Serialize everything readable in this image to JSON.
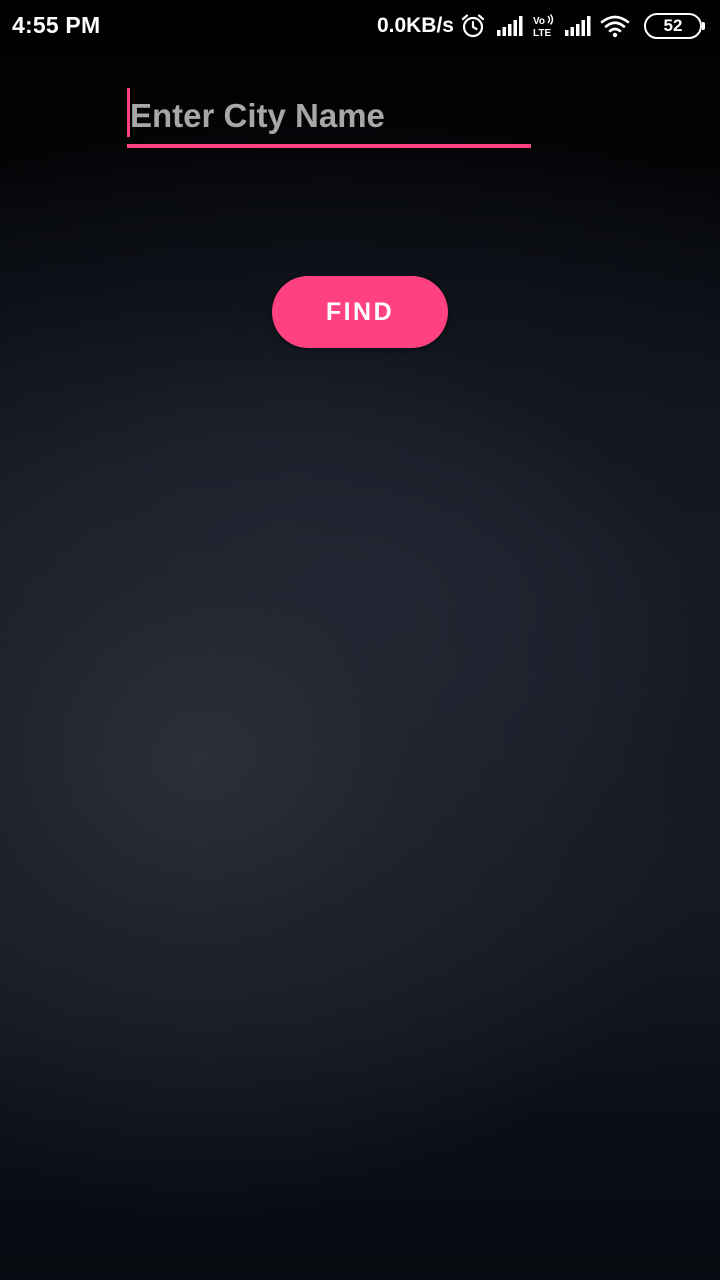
{
  "status_bar": {
    "time": "4:55 PM",
    "network_speed": "0.0KB/s",
    "battery_level": "52",
    "icons": [
      "alarm-icon",
      "signal-icon",
      "volte-lte-icon",
      "signal-icon",
      "wifi-icon",
      "battery-icon"
    ]
  },
  "search": {
    "placeholder": "Enter City Name",
    "value": ""
  },
  "find_button": {
    "label": "FIND"
  },
  "colors": {
    "accent": "#ff4081",
    "placeholder": "#a7a7aa",
    "background_top": "#000000",
    "background_mid": "#1c2230"
  }
}
